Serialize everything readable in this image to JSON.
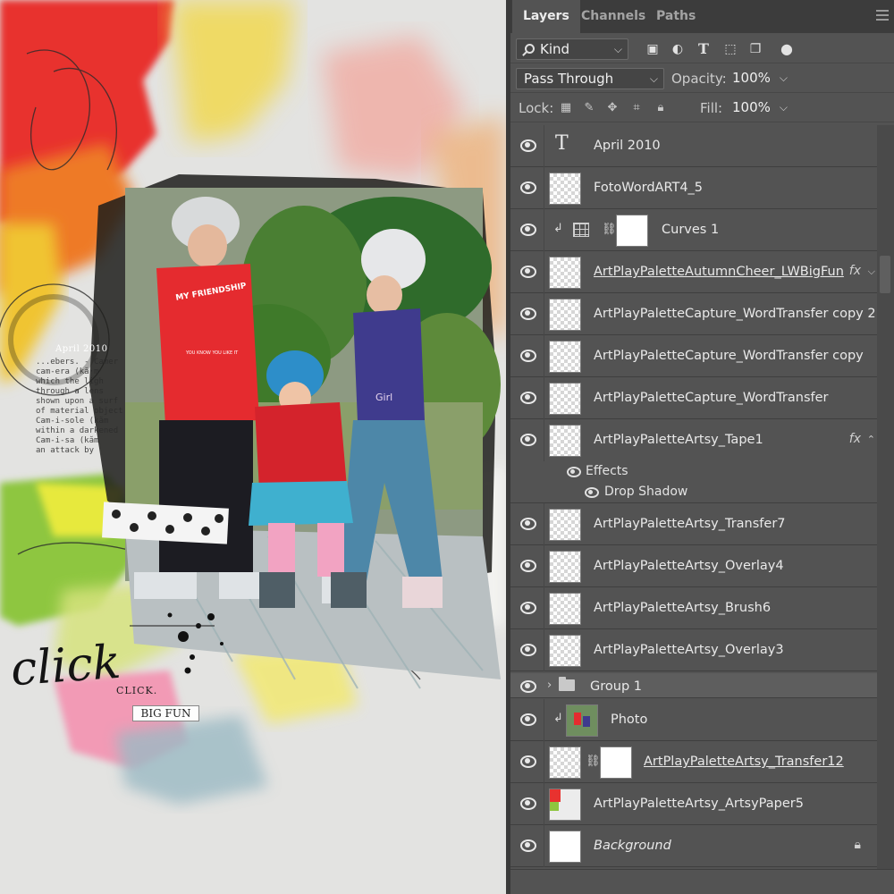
{
  "canvas": {
    "date_stamp": "April 2010",
    "script_word": "click",
    "click_label": "CLICK.",
    "big_fun_label": "BIG FUN",
    "dictionary_text": "...ebers. - Camer\ncam-era (kă·m\nwhich the ligh\nthrough a lens\nshown upon a surf\nof material object\nCam-i-sole (kăm\nwithin a darkened\nCam-i-sa (kăm\nan attack by",
    "shirt_text": "MY FRIENDSHIP",
    "shirt_subtext": "YOU KNOW YOU LIKE IT",
    "shirt2_text": "Girl"
  },
  "panel": {
    "tabs": [
      {
        "label": "Layers",
        "active": true
      },
      {
        "label": "Channels",
        "active": false
      },
      {
        "label": "Paths",
        "active": false
      }
    ],
    "filter": {
      "kind_label": "Kind"
    },
    "filter_icons": [
      "image-filter-icon",
      "adjustment-filter-icon",
      "type-filter-icon",
      "shape-filter-icon",
      "smart-object-filter-icon",
      "filter-toggle-icon"
    ],
    "blend_mode": "Pass Through",
    "opacity_label": "Opacity:",
    "opacity_value": "100%",
    "lock_label": "Lock:",
    "lock_icons": [
      "lock-transparent-icon",
      "lock-image-icon",
      "lock-position-icon",
      "lock-artboard-icon",
      "lock-all-icon"
    ],
    "fill_label": "Fill:",
    "fill_value": "100%"
  },
  "layers": [
    {
      "name": "April 2010",
      "type": "text"
    },
    {
      "name": "FotoWordART4_5",
      "type": "pixel"
    },
    {
      "name": "Curves 1",
      "type": "adjustment"
    },
    {
      "name": "ArtPlayPaletteAutumnCheer_LWBigFun",
      "type": "pixel",
      "fx": "fx"
    },
    {
      "name": "ArtPlayPaletteCapture_WordTransfer copy 2",
      "type": "pixel"
    },
    {
      "name": "ArtPlayPaletteCapture_WordTransfer copy",
      "type": "pixel"
    },
    {
      "name": "ArtPlayPaletteCapture_WordTransfer",
      "type": "pixel"
    },
    {
      "name": "ArtPlayPaletteArtsy_Tape1",
      "type": "pixel",
      "fx": "fx"
    },
    {
      "name": "ArtPlayPaletteArtsy_Transfer7",
      "type": "pixel"
    },
    {
      "name": "ArtPlayPaletteArtsy_Overlay4",
      "type": "pixel"
    },
    {
      "name": "ArtPlayPaletteArtsy_Brush6",
      "type": "pixel"
    },
    {
      "name": "ArtPlayPaletteArtsy_Overlay3",
      "type": "pixel"
    },
    {
      "name": "Group 1",
      "type": "group"
    },
    {
      "name": "Photo",
      "type": "pixel"
    },
    {
      "name": "ArtPlayPaletteArtsy_Transfer12",
      "type": "masked"
    },
    {
      "name": "ArtPlayPaletteArtsy_ArtsyPaper5",
      "type": "pixel"
    },
    {
      "name": "Background",
      "type": "background"
    }
  ],
  "effects": {
    "label": "Effects",
    "drop_shadow": "Drop Shadow"
  },
  "colors": {
    "panel_bg": "#535353",
    "tabbar_bg": "#3c3c3c",
    "text": "#e9e9e9"
  }
}
